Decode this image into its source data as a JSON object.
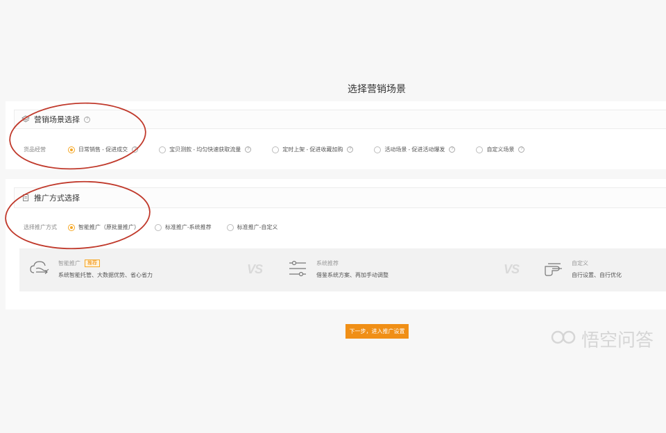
{
  "page": {
    "title": "选择营销场景"
  },
  "scene_section": {
    "title": "营销场景选择",
    "help": "?",
    "row_label": "货品经营",
    "options": [
      {
        "label": "日常销售 - 促进成交",
        "selected": true
      },
      {
        "label": "宝贝测款 - 均匀快速获取流量",
        "selected": false
      },
      {
        "label": "定时上架 - 促进收藏加购",
        "selected": false
      },
      {
        "label": "活动场景 - 促进活动爆发",
        "selected": false
      },
      {
        "label": "自定义场景",
        "selected": false
      }
    ]
  },
  "promo_section": {
    "title": "推广方式选择",
    "row_label": "选择推广方式",
    "options": [
      {
        "label": "智能推广（原批量推广）",
        "selected": true
      },
      {
        "label": "标准推广-系统推荐",
        "selected": false
      },
      {
        "label": "标准推广-自定义",
        "selected": false
      }
    ],
    "compare": [
      {
        "title": "智能推广",
        "badge": "推荐",
        "desc": "系统智能托管、大数据优势、省心省力",
        "icon": "cloud-flow-icon"
      },
      {
        "title": "系统推荐",
        "desc": "借鉴系统方案、再加手动调整",
        "icon": "sliders-icon"
      },
      {
        "title": "自定义",
        "desc": "自行设置、自行优化",
        "icon": "hand-point-icon"
      }
    ],
    "vs_label": "VS"
  },
  "next_button": {
    "label": "下一步，进入推广设置"
  },
  "watermark": {
    "text": "悟空问答"
  },
  "colors": {
    "accent": "#f08f16",
    "annotation": "#c0392b"
  }
}
